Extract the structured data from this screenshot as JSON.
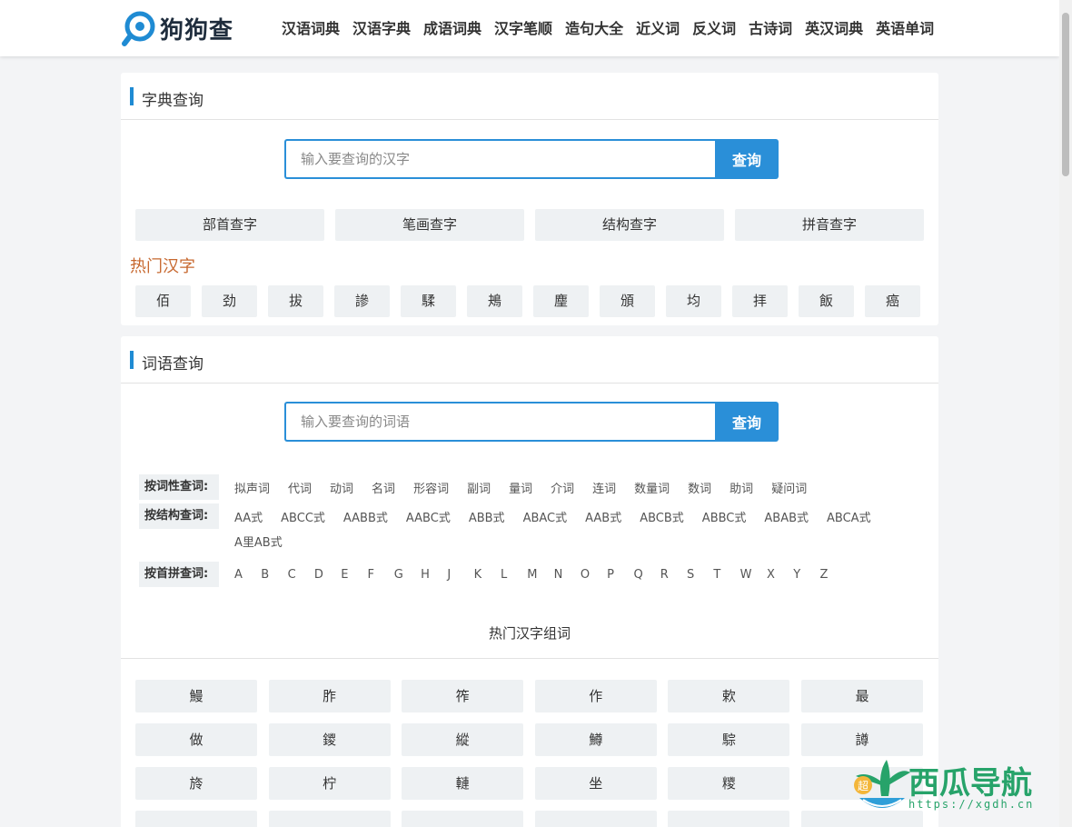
{
  "header": {
    "logo_text": "狗狗查",
    "nav": [
      "汉语词典",
      "汉语字典",
      "成语词典",
      "汉字笔顺",
      "造句大全",
      "近义词",
      "反义词",
      "古诗词",
      "英汉词典",
      "英语单词"
    ]
  },
  "dict_panel": {
    "title": "字典查询",
    "search_placeholder": "输入要查询的汉字",
    "search_button": "查询",
    "methods": [
      "部首查字",
      "笔画查字",
      "结构查字",
      "拼音查字"
    ],
    "hot_label": "热门汉字",
    "hot_chars": [
      "佰",
      "劲",
      "拔",
      "謲",
      "騥",
      "鴂",
      "麈",
      "頒",
      "均",
      "拝",
      "飯",
      "癌"
    ]
  },
  "word_panel": {
    "title": "词语查询",
    "search_placeholder": "输入要查询的词语",
    "search_button": "查询",
    "by_pos_label": "按词性查词:",
    "by_pos": [
      "拟声词",
      "代词",
      "动词",
      "名词",
      "形容词",
      "副词",
      "量词",
      "介词",
      "连词",
      "数量词",
      "数词",
      "助词",
      "疑问词"
    ],
    "by_structure_label": "按结构查词:",
    "by_structure": [
      "AA式",
      "ABCC式",
      "AABB式",
      "AABC式",
      "ABB式",
      "ABAC式",
      "AAB式",
      "ABCB式",
      "ABBC式",
      "ABAB式",
      "ABCA式"
    ],
    "by_structure_extra": "A里AB式",
    "by_pinyin_label": "按首拼查词:",
    "by_pinyin": [
      "A",
      "B",
      "C",
      "D",
      "E",
      "F",
      "G",
      "H",
      "J",
      "K",
      "L",
      "M",
      "N",
      "O",
      "P",
      "Q",
      "R",
      "S",
      "T",
      "W",
      "X",
      "Y",
      "Z"
    ],
    "hot_words_title": "热门汉字组词",
    "hot_words": [
      "鰻",
      "胙",
      "筰",
      "作",
      "欶",
      "最",
      "做",
      "鑁",
      "縱",
      "鱒",
      "騌",
      "譐",
      "旍",
      "柠",
      "轋",
      "坐",
      "糭",
      "",
      "",
      "",
      "",
      "",
      "",
      ""
    ]
  },
  "watermark": {
    "text": "西瓜导航",
    "url": "https://xgdh.cn",
    "badge": "超"
  },
  "colors": {
    "accent": "#2a8fd8",
    "hot_label": "#c7682f",
    "watermark": "#27a36a"
  }
}
